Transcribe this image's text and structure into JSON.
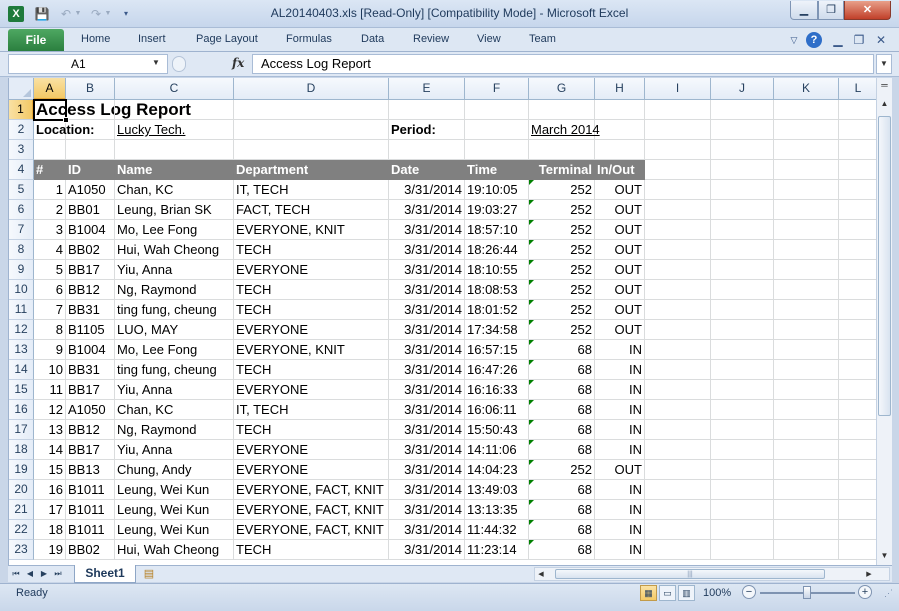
{
  "window": {
    "title": "AL20140403.xls  [Read-Only]  [Compatibility Mode]  -  Microsoft Excel",
    "app_icon": "X",
    "minimize_glyph": "▁",
    "maximize_glyph": "❐",
    "close_glyph": "✕"
  },
  "ribbon": {
    "file_tab": "File",
    "tabs": [
      "Home",
      "Insert",
      "Page Layout",
      "Formulas",
      "Data",
      "Review",
      "View",
      "Team"
    ]
  },
  "formula_bar": {
    "name_box": "A1",
    "fx_label": "fx",
    "content": "Access Log Report"
  },
  "grid": {
    "columns": [
      "A",
      "B",
      "C",
      "D",
      "E",
      "F",
      "G",
      "H",
      "I",
      "J",
      "K",
      "L"
    ],
    "row_numbers": [
      "1",
      "2",
      "3",
      "4",
      "5",
      "6",
      "7",
      "8",
      "9",
      "10",
      "11",
      "12",
      "13",
      "14",
      "15",
      "16",
      "17",
      "18",
      "19",
      "20",
      "21",
      "22",
      "23"
    ],
    "title": "Access Log Report",
    "location_label": "Location:",
    "location_value": "Lucky Tech.",
    "period_label": "Period:",
    "period_value": "March 2014",
    "headers": [
      "#",
      "ID",
      "Name",
      "Department",
      "Date",
      "Time",
      "Terminal",
      "In/Out"
    ],
    "rows": [
      [
        "1",
        "A1050",
        "Chan, KC",
        "IT, TECH",
        "3/31/2014",
        "19:10:05",
        "252",
        "OUT"
      ],
      [
        "2",
        "BB01",
        "Leung, Brian SK",
        "FACT, TECH",
        "3/31/2014",
        "19:03:27",
        "252",
        "OUT"
      ],
      [
        "3",
        "B1004",
        "Mo, Lee Fong",
        "EVERYONE, KNIT",
        "3/31/2014",
        "18:57:10",
        "252",
        "OUT"
      ],
      [
        "4",
        "BB02",
        "Hui, Wah Cheong",
        "TECH",
        "3/31/2014",
        "18:26:44",
        "252",
        "OUT"
      ],
      [
        "5",
        "BB17",
        "Yiu, Anna",
        "EVERYONE",
        "3/31/2014",
        "18:10:55",
        "252",
        "OUT"
      ],
      [
        "6",
        "BB12",
        "Ng, Raymond",
        "TECH",
        "3/31/2014",
        "18:08:53",
        "252",
        "OUT"
      ],
      [
        "7",
        "BB31",
        "ting fung, cheung",
        "TECH",
        "3/31/2014",
        "18:01:52",
        "252",
        "OUT"
      ],
      [
        "8",
        "B1105",
        "LUO, MAY",
        "EVERYONE",
        "3/31/2014",
        "17:34:58",
        "252",
        "OUT"
      ],
      [
        "9",
        "B1004",
        "Mo, Lee Fong",
        "EVERYONE, KNIT",
        "3/31/2014",
        "16:57:15",
        "68",
        "IN"
      ],
      [
        "10",
        "BB31",
        "ting fung, cheung",
        "TECH",
        "3/31/2014",
        "16:47:26",
        "68",
        "IN"
      ],
      [
        "11",
        "BB17",
        "Yiu, Anna",
        "EVERYONE",
        "3/31/2014",
        "16:16:33",
        "68",
        "IN"
      ],
      [
        "12",
        "A1050",
        "Chan, KC",
        "IT, TECH",
        "3/31/2014",
        "16:06:11",
        "68",
        "IN"
      ],
      [
        "13",
        "BB12",
        "Ng, Raymond",
        "TECH",
        "3/31/2014",
        "15:50:43",
        "68",
        "IN"
      ],
      [
        "14",
        "BB17",
        "Yiu, Anna",
        "EVERYONE",
        "3/31/2014",
        "14:11:06",
        "68",
        "IN"
      ],
      [
        "15",
        "BB13",
        "Chung, Andy",
        "EVERYONE",
        "3/31/2014",
        "14:04:23",
        "252",
        "OUT"
      ],
      [
        "16",
        "B1011",
        "Leung, Wei Kun",
        "EVERYONE, FACT, KNIT",
        "3/31/2014",
        "13:49:03",
        "68",
        "IN"
      ],
      [
        "17",
        "B1011",
        "Leung, Wei Kun",
        "EVERYONE, FACT, KNIT",
        "3/31/2014",
        "13:13:35",
        "68",
        "IN"
      ],
      [
        "18",
        "B1011",
        "Leung, Wei Kun",
        "EVERYONE, FACT, KNIT",
        "3/31/2014",
        "11:44:32",
        "68",
        "IN"
      ],
      [
        "19",
        "BB02",
        "Hui, Wah Cheong",
        "TECH",
        "3/31/2014",
        "11:23:14",
        "68",
        "IN"
      ]
    ]
  },
  "sheets": {
    "active": "Sheet1"
  },
  "status": {
    "text": "Ready",
    "zoom": "100%"
  }
}
